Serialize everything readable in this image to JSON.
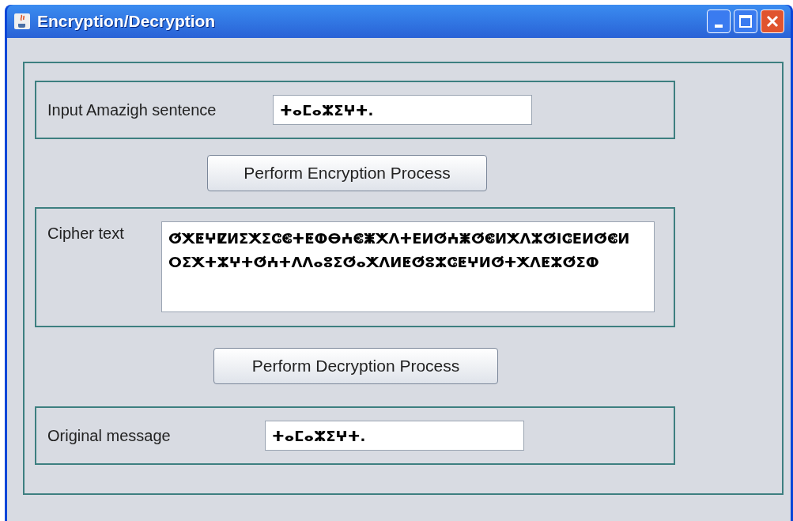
{
  "window": {
    "title": "Encryption/Decryption"
  },
  "input": {
    "label": "Input Amazigh sentence",
    "value": "ⵜⴰⵎⴰⵣⵉⵖⵜ."
  },
  "encrypt_button": "Perform Encryption Process",
  "cipher": {
    "label": "Cipher text",
    "value": "ⵚⵅⵟⵖⵇⵍⵉⵅⵉⵛⵞⵜⵟⵀⴱⵄⵞⵥⵅⴷⵜⴹⵍⵚⵄⵥⵚⵞⵍⵅⴷⵣⵚⵏⵛⴹⵍⵚⵞⵍ ⵔⵉⵅⵜⵣⵖⵜⵚⵄⵜⴷⴷⴰⵓⵉⵚⴰⵅⴷⵍⵟⵚⵓⵣⵛⵟⵖⵍⵚⵜⵅⴷⵟⵣⵚⵉⵀ"
  },
  "decrypt_button": "Perform Decryption Process",
  "output": {
    "label": "Original message",
    "value": "ⵜⴰⵎⴰⵣⵉⵖⵜ."
  }
}
